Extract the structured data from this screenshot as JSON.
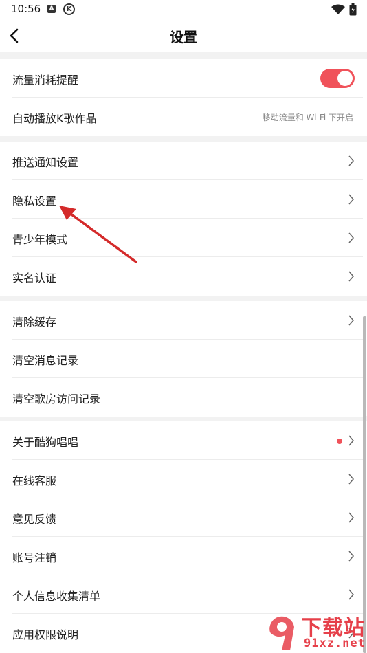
{
  "status": {
    "time": "10:56",
    "icon_a": "A",
    "icon_k": "K"
  },
  "header": {
    "title": "设置"
  },
  "groups": [
    {
      "items": [
        {
          "label": "流量消耗提醒",
          "control": "toggle",
          "on": true
        },
        {
          "label": "自动播放K歌作品",
          "note": "移动流量和 Wi-Fi 下开启"
        }
      ]
    },
    {
      "items": [
        {
          "label": "推送通知设置"
        },
        {
          "label": "隐私设置"
        },
        {
          "label": "青少年模式"
        },
        {
          "label": "实名认证"
        }
      ]
    },
    {
      "items": [
        {
          "label": "清除缓存"
        },
        {
          "label": "清空消息记录"
        },
        {
          "label": "清空歌房访问记录"
        }
      ]
    },
    {
      "items": [
        {
          "label": "关于酷狗唱唱",
          "badge": "red-dot"
        },
        {
          "label": "在线客服"
        },
        {
          "label": "意见反馈"
        },
        {
          "label": "账号注销"
        },
        {
          "label": "个人信息收集清单"
        },
        {
          "label": "应用权限说明"
        }
      ]
    }
  ],
  "watermark": {
    "big": "下载站",
    "small": "91xz.net",
    "logo": "9f"
  },
  "colors": {
    "accent": "#f0525a",
    "annotation_arrow": "#d42a2a"
  }
}
